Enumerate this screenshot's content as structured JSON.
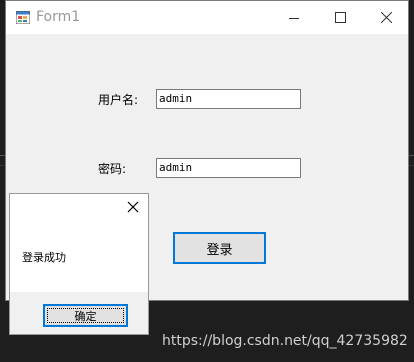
{
  "window": {
    "title": "Form1"
  },
  "form": {
    "username_label": "用户名:",
    "username_value": "admin",
    "password_label": "密码:",
    "password_value": "admin",
    "login_button": "登录"
  },
  "messagebox": {
    "message": "登录成功",
    "ok_button": "确定"
  },
  "watermark": "https://blog.csdn.net/qq_42735982"
}
